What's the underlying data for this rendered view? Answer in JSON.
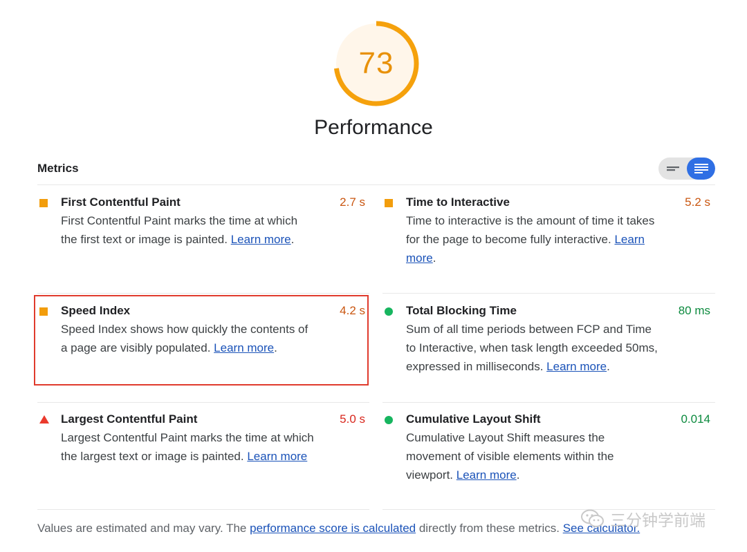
{
  "score": {
    "value": "73",
    "fraction": 0.73,
    "color": "#f5a10c"
  },
  "category_title": "Performance",
  "metrics_header": "Metrics",
  "view_toggle": {
    "left_icon": "compact-view-icon",
    "right_icon": "expanded-view-icon",
    "active": "right"
  },
  "colors": {
    "average": "#f29d0c",
    "fail": "#ea3a2d",
    "pass": "#17b55f",
    "link": "#1a52b8",
    "highlight": "#e03a2c"
  },
  "metrics": [
    {
      "title": "First Contentful Paint",
      "value": "2.7 s",
      "status": "average",
      "value_color": "#c9550f",
      "desc": "First Contentful Paint marks the time at which the first text or image is painted.",
      "link": "Learn more",
      "after_link": "."
    },
    {
      "title": "Time to Interactive",
      "value": "5.2 s",
      "status": "average",
      "value_color": "#c9550f",
      "desc": "Time to interactive is the amount of time it takes for the page to become fully interactive.",
      "link": "Learn more",
      "after_link": "."
    },
    {
      "title": "Speed Index",
      "value": "4.2 s",
      "status": "average",
      "value_color": "#c9550f",
      "desc": "Speed Index shows how quickly the contents of a page are visibly populated.",
      "link": "Learn more",
      "after_link": "."
    },
    {
      "title": "Total Blocking Time",
      "value": "80 ms",
      "status": "pass",
      "value_color": "#0c8a3e",
      "desc": "Sum of all time periods between FCP and Time to Interactive, when task length exceeded 50ms, expressed in milliseconds.",
      "link": "Learn more",
      "after_link": "."
    },
    {
      "title": "Largest Contentful Paint",
      "value": "5.0 s",
      "status": "fail",
      "value_color": "#d8261c",
      "desc": "Largest Contentful Paint marks the time at which the largest text or image is painted.",
      "link": "Learn more",
      "after_link": ""
    },
    {
      "title": "Cumulative Layout Shift",
      "value": "0.014",
      "status": "pass",
      "value_color": "#0c8a3e",
      "desc": "Cumulative Layout Shift measures the movement of visible elements within the viewport.",
      "link": "Learn more",
      "after_link": "."
    }
  ],
  "footer": {
    "text1": "Values are estimated and may vary. The ",
    "link1": "performance score is calculated",
    "text2": " directly from these metrics. ",
    "link2": "See calculator."
  },
  "watermark": {
    "icon": "wechat-icon",
    "text": "三分钟学前端"
  }
}
